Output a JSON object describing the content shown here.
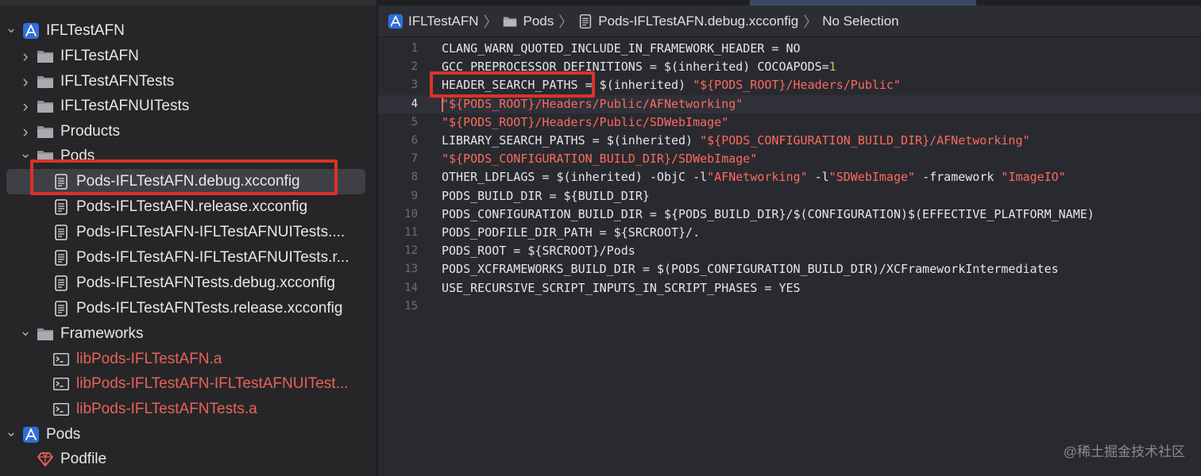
{
  "sidebar": {
    "items": [
      {
        "label": "IFLTestAFN",
        "icon": "project-icon",
        "disclosure": "expanded"
      },
      {
        "label": "IFLTestAFN",
        "icon": "folder-icon",
        "disclosure": "collapsed"
      },
      {
        "label": "IFLTestAFNTests",
        "icon": "folder-icon",
        "disclosure": "collapsed"
      },
      {
        "label": "IFLTestAFNUITests",
        "icon": "folder-icon",
        "disclosure": "collapsed"
      },
      {
        "label": "Products",
        "icon": "folder-icon",
        "disclosure": "collapsed"
      },
      {
        "label": "Pods",
        "icon": "folder-icon",
        "disclosure": "expanded"
      },
      {
        "label": "Pods-IFLTestAFN.debug.xcconfig",
        "icon": "document-icon",
        "selected": true
      },
      {
        "label": "Pods-IFLTestAFN.release.xcconfig",
        "icon": "document-icon"
      },
      {
        "label": "Pods-IFLTestAFN-IFLTestAFNUITests....",
        "icon": "document-icon"
      },
      {
        "label": "Pods-IFLTestAFN-IFLTestAFNUITests.r...",
        "icon": "document-icon"
      },
      {
        "label": "Pods-IFLTestAFNTests.debug.xcconfig",
        "icon": "document-icon"
      },
      {
        "label": "Pods-IFLTestAFNTests.release.xcconfig",
        "icon": "document-icon"
      },
      {
        "label": "Frameworks",
        "icon": "folder-icon",
        "disclosure": "expanded"
      },
      {
        "label": "libPods-IFLTestAFN.a",
        "icon": "library-icon",
        "missing": true
      },
      {
        "label": "libPods-IFLTestAFN-IFLTestAFNUITest...",
        "icon": "library-icon",
        "missing": true
      },
      {
        "label": "libPods-IFLTestAFNTests.a",
        "icon": "library-icon",
        "missing": true
      },
      {
        "label": "Pods",
        "icon": "project-icon",
        "disclosure": "expanded"
      },
      {
        "label": "Podfile",
        "icon": "ruby-icon"
      }
    ]
  },
  "jumpbar": {
    "crumbs": [
      "IFLTestAFN",
      "Pods",
      "Pods-IFLTestAFN.debug.xcconfig",
      "No Selection"
    ]
  },
  "editor": {
    "current_line": 4,
    "lines": [
      {
        "n": "1",
        "text": "CLANG_WARN_QUOTED_INCLUDE_IN_FRAMEWORK_HEADER = NO"
      },
      {
        "n": "2",
        "text": "GCC_PREPROCESSOR_DEFINITIONS = $(inherited) COCOAPODS=1"
      },
      {
        "n": "3",
        "text": "HEADER_SEARCH_PATHS = $(inherited) \"${PODS_ROOT}/Headers/Public\""
      },
      {
        "n": "4",
        "text": "\"${PODS_ROOT}/Headers/Public/AFNetworking\""
      },
      {
        "n": "5",
        "text": "\"${PODS_ROOT}/Headers/Public/SDWebImage\""
      },
      {
        "n": "6",
        "text": "LIBRARY_SEARCH_PATHS = $(inherited) \"${PODS_CONFIGURATION_BUILD_DIR}/AFNetworking\""
      },
      {
        "n": "7",
        "text": "\"${PODS_CONFIGURATION_BUILD_DIR}/SDWebImage\""
      },
      {
        "n": "8",
        "text": "OTHER_LDFLAGS = $(inherited) -ObjC -l\"AFNetworking\" -l\"SDWebImage\" -framework \"ImageIO\""
      },
      {
        "n": "9",
        "text": "PODS_BUILD_DIR = ${BUILD_DIR}"
      },
      {
        "n": "10",
        "text": "PODS_CONFIGURATION_BUILD_DIR = ${PODS_BUILD_DIR}/$(CONFIGURATION)$(EFFECTIVE_PLATFORM_NAME)"
      },
      {
        "n": "11",
        "text": "PODS_PODFILE_DIR_PATH = ${SRCROOT}/."
      },
      {
        "n": "12",
        "text": "PODS_ROOT = ${SRCROOT}/Pods"
      },
      {
        "n": "13",
        "text": "PODS_XCFRAMEWORKS_BUILD_DIR = $(PODS_CONFIGURATION_BUILD_DIR)/XCFrameworkIntermediates"
      },
      {
        "n": "14",
        "text": "USE_RECURSIVE_SCRIPT_INPUTS_IN_SCRIPT_PHASES = YES"
      },
      {
        "n": "15",
        "text": ""
      }
    ]
  },
  "watermark": "@稀土掘金技术社区",
  "colors": {
    "string": "#fc6a5d",
    "number": "#d0bf69",
    "highlight_box": "#d93329",
    "missing_file": "#e8625a"
  }
}
